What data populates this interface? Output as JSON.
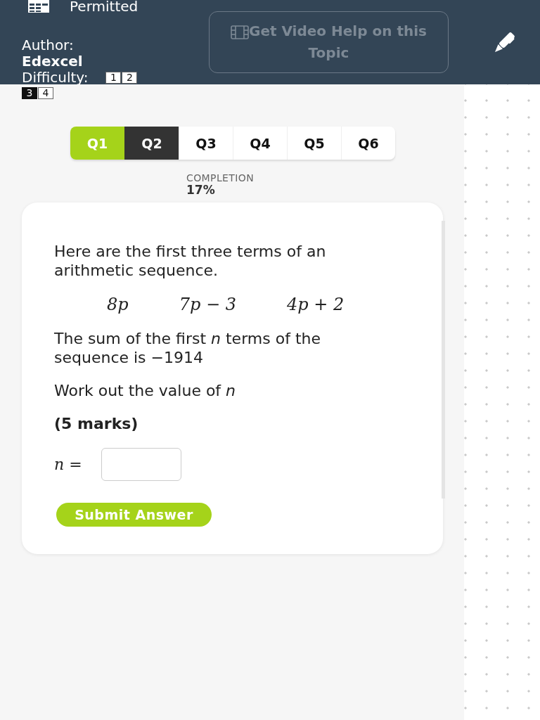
{
  "header": {
    "calculator": {
      "label": "Permitted"
    },
    "author": {
      "label": "Author:",
      "value": "Edexcel"
    },
    "difficulty": {
      "label": "Difficulty:",
      "levels": [
        {
          "label": "1",
          "selected": false
        },
        {
          "label": "2",
          "selected": false
        },
        {
          "label": "3",
          "selected": true
        },
        {
          "label": "4",
          "selected": false
        }
      ]
    },
    "video_help": {
      "label": "Get Video Help on this Topic",
      "disabled": true
    }
  },
  "question_tabs": [
    {
      "label": "Q1",
      "selected": false,
      "completed": true
    },
    {
      "label": "Q2",
      "selected": true,
      "completed": false
    },
    {
      "label": "Q3",
      "selected": false,
      "completed": false
    },
    {
      "label": "Q4",
      "selected": false,
      "completed": false
    },
    {
      "label": "Q5",
      "selected": false,
      "completed": false
    },
    {
      "label": "Q6",
      "selected": false,
      "completed": false
    }
  ],
  "completion": {
    "label": "COMPLETION",
    "value": "17%"
  },
  "question": {
    "blocks": [
      {
        "kind": "paragraph",
        "text": "Here are the first three terms of an arithmetic sequence."
      },
      {
        "kind": "terms",
        "items": [
          "8p",
          "7p − 3",
          "4p + 2"
        ]
      },
      {
        "kind": "paragraph",
        "text": "The sum of the first *n* terms of the sequence is −1914"
      },
      {
        "kind": "paragraph",
        "text": "Work out the value of *n*"
      },
      {
        "kind": "marks",
        "text": "(5 marks)"
      }
    ],
    "answer": {
      "label": "*n* ="
    },
    "submit": {
      "label": "Submit Answer"
    }
  }
}
